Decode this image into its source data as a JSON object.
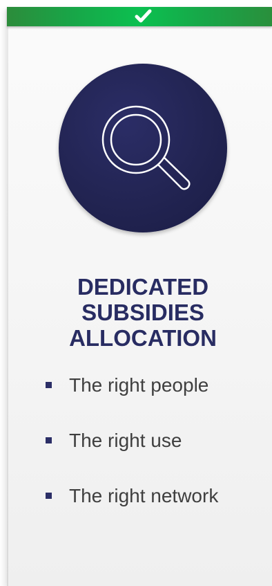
{
  "header": {
    "icon": "checkmark-icon",
    "accent_color": "#18a648"
  },
  "badge": {
    "icon": "search-icon",
    "circle_color": "#222452"
  },
  "title": {
    "lines": [
      "DEDICATED",
      "SUBSIDIES",
      "ALLOCATION"
    ],
    "color": "#282c62"
  },
  "list": {
    "items": [
      {
        "label": "The right people"
      },
      {
        "label": "The right use"
      },
      {
        "label": "The right network"
      }
    ]
  }
}
